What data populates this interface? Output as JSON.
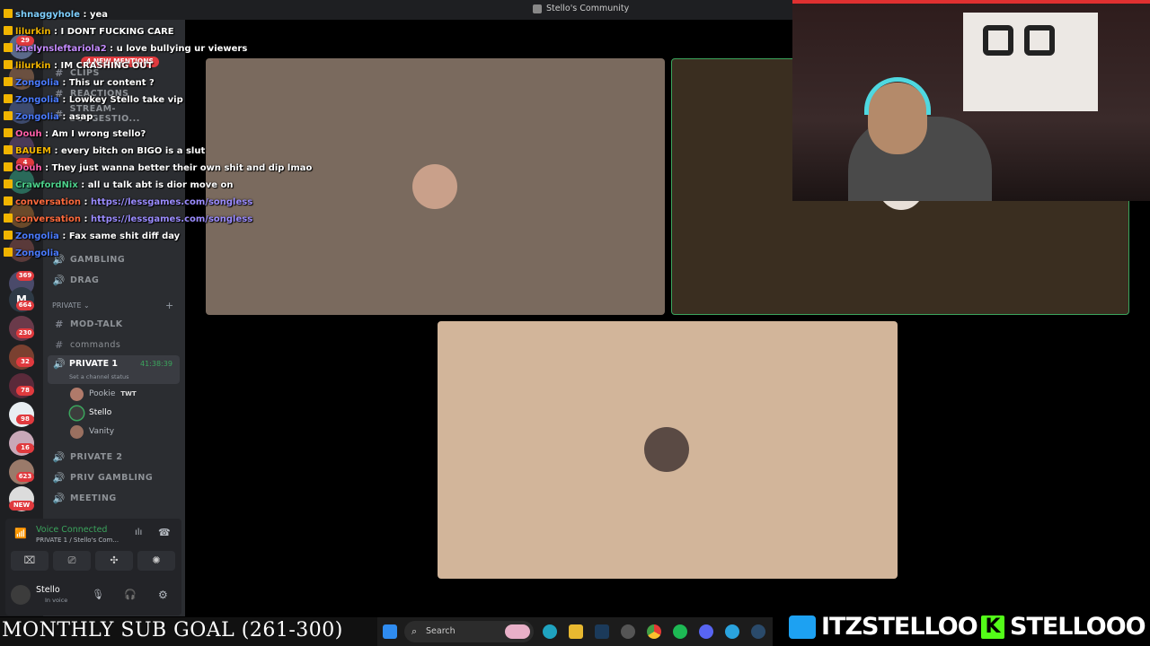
{
  "window": {
    "title": "Stello's Community"
  },
  "servers": {
    "badges": [
      "29",
      "4",
      "4",
      "369",
      "664",
      "230",
      "32",
      "78",
      "98",
      "16",
      "623",
      "NEW"
    ]
  },
  "channels": {
    "mention_pill": "4 NEW MENTIONS",
    "items_top": [
      "CLIPS",
      "REACTIONS",
      "STREAM-SUGGESTIO..."
    ],
    "voice_a": [
      "GAMBLING",
      "DRAG"
    ],
    "private_header": "PRIVATE",
    "private_items": [
      "MOD-TALK",
      "commands"
    ],
    "private1": {
      "name": "PRIVATE 1",
      "timer": "41:38:39",
      "status": "Set a channel status"
    },
    "voice_users": [
      {
        "name": "Pookie",
        "tag": "TWT"
      },
      {
        "name": "Stello",
        "tag": ""
      },
      {
        "name": "Vanity",
        "tag": ""
      }
    ],
    "after": [
      "PRIVATE 2",
      "PRIV GAMBLING",
      "MEETING"
    ]
  },
  "voice_panel": {
    "status": "Voice Connected",
    "location": "PRIVATE 1 / Stello's Com...",
    "user": "Stello",
    "user_status": "In voice"
  },
  "chat": [
    {
      "user": "shnaggyhole",
      "color": "#7fd0ff",
      "msg": "yea",
      "link": false
    },
    {
      "user": "lilurkin",
      "color": "#f0b400",
      "msg": "I DONT FUCKING CARE",
      "link": false
    },
    {
      "user": "kaelynsleftariola2",
      "color": "#c58cff",
      "msg": "u love bullying ur viewers",
      "link": false
    },
    {
      "user": "lilurkin",
      "color": "#f0b400",
      "msg": "IM CRASHING OUT",
      "link": false
    },
    {
      "user": "Zongolia",
      "color": "#4a7bff",
      "msg": "This ur content ?",
      "link": false
    },
    {
      "user": "Zongolia",
      "color": "#4a7bff",
      "msg": "Lowkey Stello take vip",
      "link": false
    },
    {
      "user": "Zongolia",
      "color": "#4a7bff",
      "msg": "asap",
      "link": false
    },
    {
      "user": "Oouh",
      "color": "#ff5fa8",
      "msg": "Am I wrong stello?",
      "link": false
    },
    {
      "user": "BAUEM",
      "color": "#f0b400",
      "msg": "every bitch on BIGO is a slut",
      "link": false
    },
    {
      "user": "Oouh",
      "color": "#ff5fa8",
      "msg": "They just wanna better their own shit and dip lmao",
      "link": false
    },
    {
      "user": "CrawfordNix",
      "color": "#4cd08a",
      "msg": "all u talk abt is dior move on",
      "link": false
    },
    {
      "user": "conversation",
      "color": "#ff6a3d",
      "msg": "https://lessgames.com/songless",
      "link": true
    },
    {
      "user": "conversation",
      "color": "#ff6a3d",
      "msg": "https://lessgames.com/songless",
      "link": true
    },
    {
      "user": "Zongolia",
      "color": "#4a7bff",
      "msg": "Fax same shit diff day",
      "link": false
    },
    {
      "user": "Zongolia",
      "color": "#4a7bff",
      "msg": "",
      "link": false
    }
  ],
  "overlay": {
    "goal": "MONTHLY SUB GOAL (261-300)",
    "twitter": "ITZSTELLOO",
    "kick": "STELLOOO"
  },
  "taskbar": {
    "search_placeholder": "Search"
  },
  "colors": {
    "tile1": "#7a6a5e",
    "tile2": "#3a2e20",
    "tile3": "#d2b59a",
    "speaking": "#3ba55d"
  }
}
